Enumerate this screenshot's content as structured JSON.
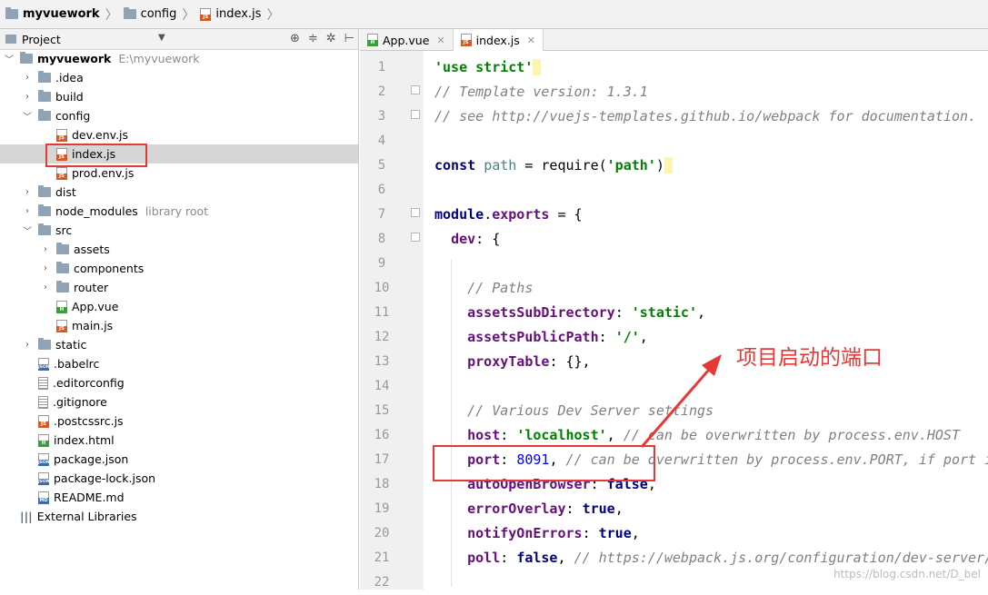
{
  "breadcrumb": [
    "myvuework",
    "config",
    "index.js"
  ],
  "project_panel": {
    "title": "Project",
    "tree": [
      {
        "label": "myvuework",
        "hint": "E:\\myvuework",
        "type": "root",
        "depth": 0,
        "expanded": true
      },
      {
        "label": ".idea",
        "type": "folder",
        "depth": 1,
        "expanded": false
      },
      {
        "label": "build",
        "type": "folder",
        "depth": 1,
        "expanded": false
      },
      {
        "label": "config",
        "type": "folder",
        "depth": 1,
        "expanded": true
      },
      {
        "label": "dev.env.js",
        "type": "js",
        "depth": 2
      },
      {
        "label": "index.js",
        "type": "js",
        "depth": 2,
        "selected": true
      },
      {
        "label": "prod.env.js",
        "type": "js",
        "depth": 2
      },
      {
        "label": "dist",
        "type": "folder",
        "depth": 1,
        "expanded": false
      },
      {
        "label": "node_modules",
        "hint": "library root",
        "type": "folder",
        "depth": 1,
        "expanded": false
      },
      {
        "label": "src",
        "type": "folder",
        "depth": 1,
        "expanded": true
      },
      {
        "label": "assets",
        "type": "folder",
        "depth": 2,
        "expanded": false
      },
      {
        "label": "components",
        "type": "folder",
        "depth": 2,
        "expanded": false
      },
      {
        "label": "router",
        "type": "folder",
        "depth": 2,
        "expanded": false
      },
      {
        "label": "App.vue",
        "type": "vue",
        "depth": 2
      },
      {
        "label": "main.js",
        "type": "js",
        "depth": 2
      },
      {
        "label": "static",
        "type": "folder",
        "depth": 1,
        "expanded": false
      },
      {
        "label": ".babelrc",
        "type": "json",
        "depth": 1
      },
      {
        "label": ".editorconfig",
        "type": "txt",
        "depth": 1
      },
      {
        "label": ".gitignore",
        "type": "txt",
        "depth": 1
      },
      {
        "label": ".postcssrc.js",
        "type": "js",
        "depth": 1
      },
      {
        "label": "index.html",
        "type": "html",
        "depth": 1
      },
      {
        "label": "package.json",
        "type": "json",
        "depth": 1
      },
      {
        "label": "package-lock.json",
        "type": "json",
        "depth": 1
      },
      {
        "label": "README.md",
        "type": "md",
        "depth": 1
      },
      {
        "label": "External Libraries",
        "type": "lib",
        "depth": 0
      }
    ]
  },
  "editor": {
    "tabs": [
      {
        "label": "App.vue",
        "active": false
      },
      {
        "label": "index.js",
        "active": true
      }
    ],
    "line_numbers": [
      "1",
      "2",
      "3",
      "4",
      "5",
      "6",
      "7",
      "8",
      "9",
      "10",
      "11",
      "12",
      "13",
      "14",
      "15",
      "16",
      "17",
      "18",
      "19",
      "20",
      "21",
      "22"
    ]
  },
  "annotation": {
    "text": "项目启动的端口",
    "color": "#e53935"
  },
  "watermark": "https://blog.csdn.net/D_bel"
}
